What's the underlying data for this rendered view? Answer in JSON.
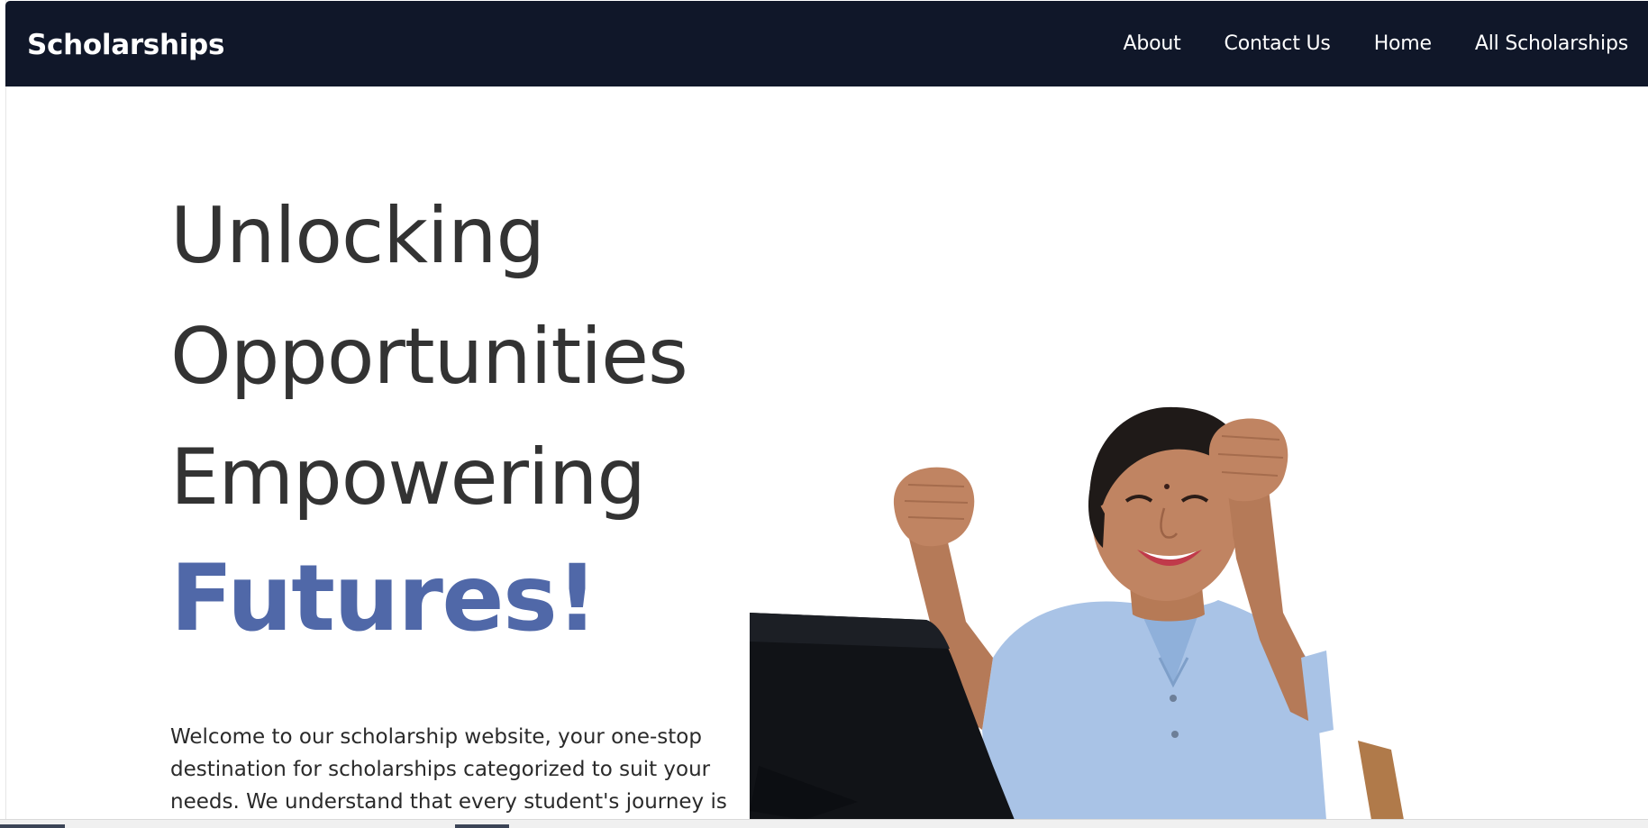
{
  "nav": {
    "brand": "Scholarships",
    "links": [
      "About",
      "Contact Us",
      "Home",
      "All Scholarships"
    ]
  },
  "hero": {
    "lines": [
      "Unlocking",
      "Opportunities",
      "Empowering"
    ],
    "accent": "Futures!",
    "intro": "Welcome to our scholarship website, your one-stop destination for scholarships categorized to suit your needs. We understand that every student's journey is"
  },
  "image": {
    "description_icon": "student-celebrating-laptop-image"
  },
  "colors": {
    "navbar_bg": "#101729",
    "heading_text": "#333333",
    "accent": "#5068a8",
    "nav_text": "#ffffff"
  }
}
